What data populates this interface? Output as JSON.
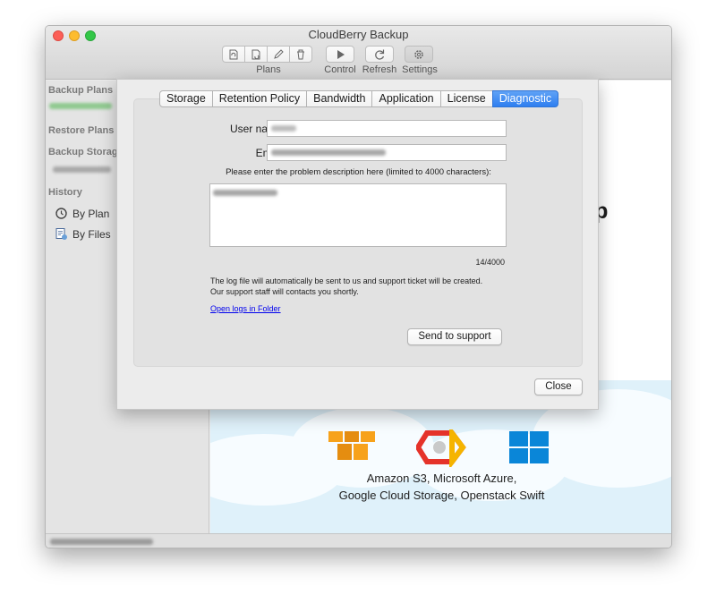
{
  "window": {
    "title": "CloudBerry Backup"
  },
  "toolbar": {
    "plans_label": "Plans",
    "control_label": "Control",
    "refresh_label": "Refresh",
    "settings_label": "Settings"
  },
  "sidebar": {
    "backup_plans": "Backup Plans",
    "restore_plans": "Restore Plans",
    "backup_storage": "Backup Storage",
    "history": "History",
    "by_plan": "By Plan",
    "by_files": "By Files"
  },
  "main": {
    "title_fragment": "kup",
    "providers_line1": "Amazon S3, Microsoft Azure,",
    "providers_line2": "Google Cloud Storage, Openstack Swift"
  },
  "dialog": {
    "tabs": [
      "Storage",
      "Retention Policy",
      "Bandwidth",
      "Application",
      "License",
      "Diagnostic"
    ],
    "active_tab": "Diagnostic",
    "username_label": "User name:",
    "email_label": "Email:",
    "description_label": "Please enter the problem description here (limited to 4000 characters):",
    "char_count": "14/4000",
    "note": "The log file will automatically be sent to us and support ticket will be created.\nOur support staff will contacts you shortly.",
    "open_logs_link": "Open logs in Folder",
    "send_button": "Send to support",
    "close_button": "Close"
  },
  "colors": {
    "active_tab": "#2f7ff0",
    "link": "#0000ee",
    "sky": "#dff1fa",
    "aws_orange": "#f7a21b",
    "azure_blue": "#0a86d8"
  }
}
